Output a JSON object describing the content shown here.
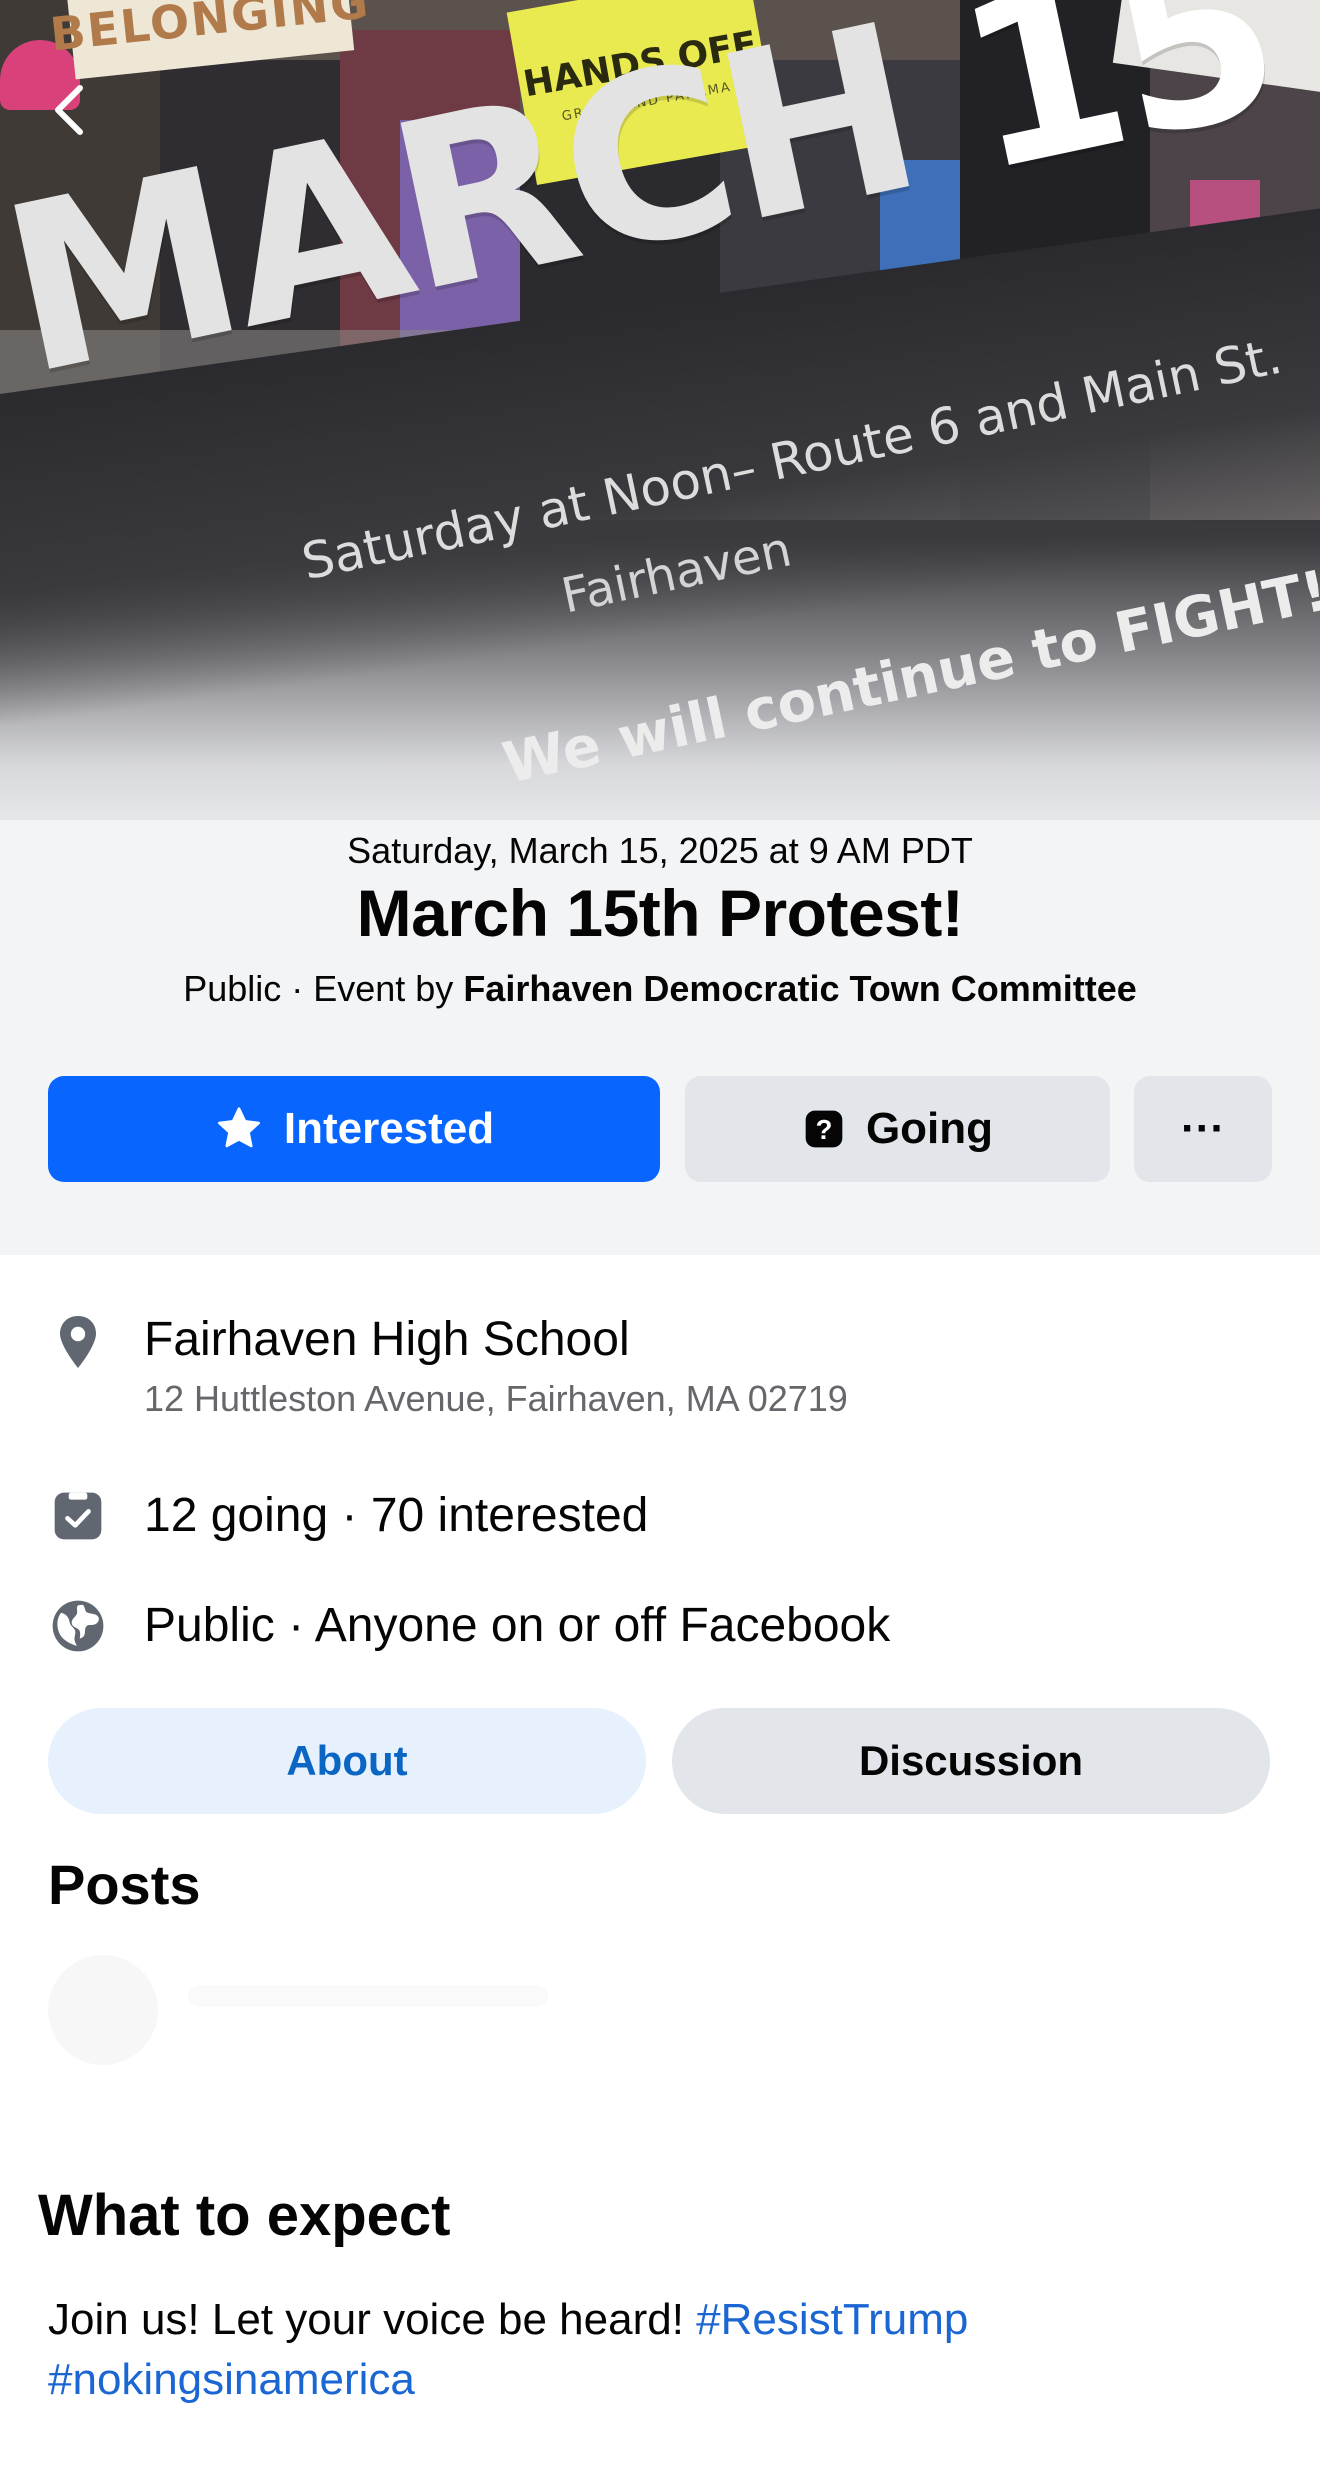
{
  "cover": {
    "signs": [
      "BELONGING",
      "HANDS OFF",
      "GREENLAND PANAMA"
    ],
    "poster_title_word": "MARCH",
    "poster_title_number": "15",
    "poster_line1": "Saturday at Noon– Route 6 and Main St.",
    "poster_line2": "Fairhaven",
    "poster_line3": "We will continue to FIGHT!"
  },
  "nav": {
    "back_icon": "chevron-left-icon"
  },
  "event": {
    "date": "Saturday, March 15, 2025 at 9 AM PDT",
    "title": "March 15th Protest!",
    "host_prefix": "Public · Event by ",
    "host_name": "Fairhaven Democratic Town Committee"
  },
  "actions": {
    "interested_label": "Interested",
    "interested_icon": "star-icon",
    "going_label": "Going",
    "going_icon": "question-icon",
    "more_label": "···"
  },
  "details": {
    "location_name": "Fairhaven High School",
    "location_address": "12 Huttleston Avenue, Fairhaven, MA 02719",
    "attendance": "12 going · 70 interested",
    "privacy": "Public · Anyone on or off Facebook"
  },
  "tabs": {
    "about": "About",
    "discussion": "Discussion"
  },
  "posts": {
    "heading": "Posts"
  },
  "expect": {
    "heading": "What to expect",
    "body": "Join us! Let your voice be heard! ",
    "hashtag1": "#ResistTrump",
    "hashtag2": "#nokingsinamerica"
  },
  "colors": {
    "accent": "#0866ff",
    "button_gray": "#e2e5e9",
    "about_tab_bg": "#e7f1fd",
    "about_tab_text": "#0a66c2",
    "hashtag": "#1a66d2",
    "muted_text": "#65676b"
  }
}
